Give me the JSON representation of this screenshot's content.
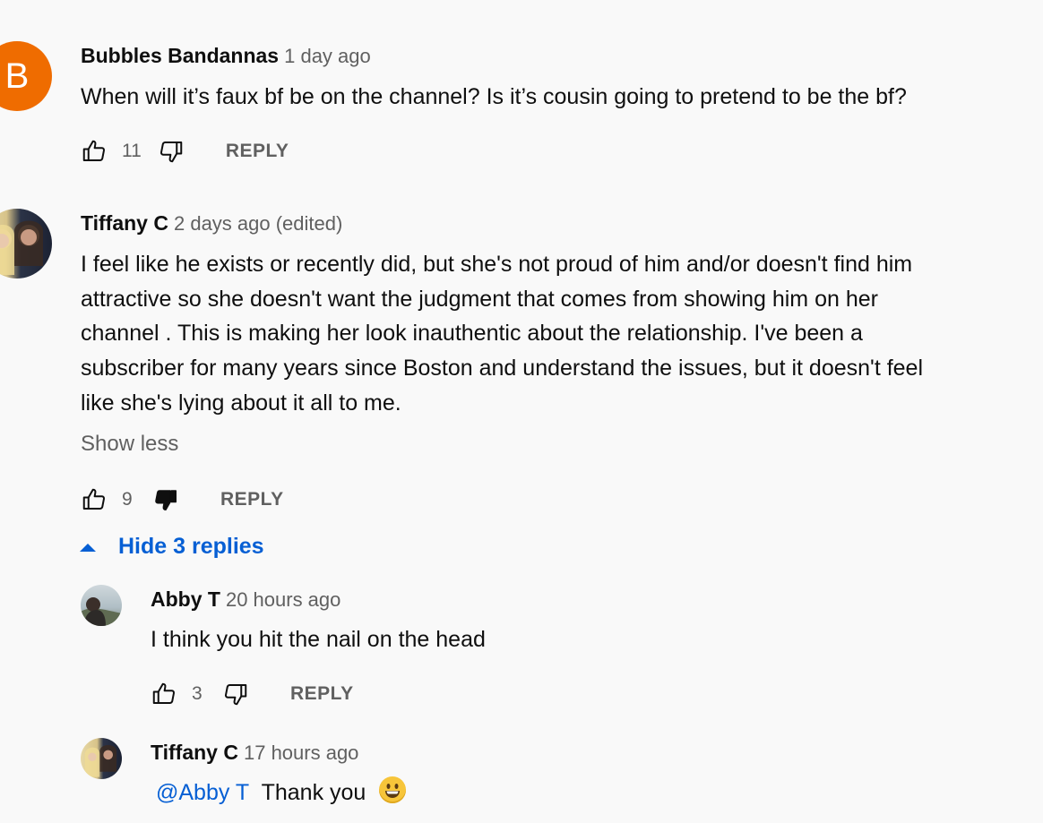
{
  "comments": [
    {
      "avatar_letter": "B",
      "avatar_color": "#ef6c00",
      "author": "Bubbles Bandannas",
      "time": "1 day ago",
      "text": "When will it’s faux bf be on the channel? Is it’s cousin going to pretend to be the bf?",
      "likes": "11",
      "reply_label": "REPLY"
    },
    {
      "author": "Tiffany C",
      "time": "2 days ago (edited)",
      "text_lines": [
        "I feel like he exists or recently did, but  she's not proud of him and/or doesn't find him",
        "attractive so she doesn't want the judgment that comes from showing him on her",
        "channel . This is making her look inauthentic about the relationship. I've been a",
        "subscriber for many years since Boston and understand the issues, but it doesn't feel",
        "like she's lying about it all to me."
      ],
      "show_less": "Show less",
      "likes": "9",
      "reply_label": "REPLY",
      "hide_replies": "Hide 3 replies",
      "replies": [
        {
          "author": "Abby T",
          "time": "20 hours ago",
          "text": "I think you hit the nail on the head",
          "likes": "3",
          "reply_label": "REPLY"
        },
        {
          "author": "Tiffany C",
          "time": "17 hours ago",
          "mention": "@Abby T",
          "text": "Thank you"
        }
      ]
    }
  ],
  "colors": {
    "link": "#065fd4",
    "secondary": "#606060",
    "background": "#f9f9f9"
  },
  "icons": [
    "thumbs-up-icon",
    "thumbs-down-icon",
    "caret-up-icon",
    "grinning-emoji-icon"
  ]
}
